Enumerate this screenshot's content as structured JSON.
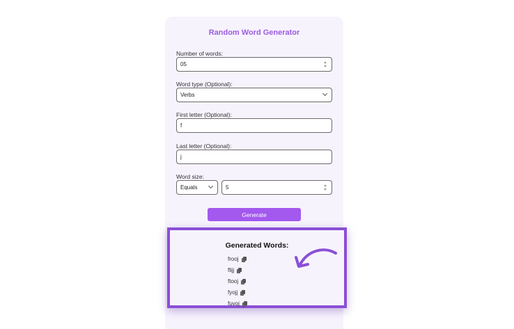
{
  "generator": {
    "title": "Random Word Generator",
    "number_of_words": {
      "label": "Number of words:",
      "value": "05"
    },
    "word_type": {
      "label": "Word type (Optional):",
      "value": "Verbs"
    },
    "first_letter": {
      "label": "First letter (Optional):",
      "value": "f"
    },
    "last_letter": {
      "label": "Last letter (Optional):",
      "value": "j"
    },
    "word_size": {
      "label": "Word size:",
      "comparator": "Equals",
      "value": "5"
    },
    "generate_label": "Generate"
  },
  "results": {
    "title": "Generated Words:",
    "words": [
      "frooj",
      "flijj",
      "ftooj",
      "fyojj",
      "fuvoj"
    ]
  },
  "colors": {
    "accent": "#a358ee",
    "title": "#9c5be0",
    "highlight_border": "#8a4fd6",
    "card_bg": "#f7f3fd"
  }
}
